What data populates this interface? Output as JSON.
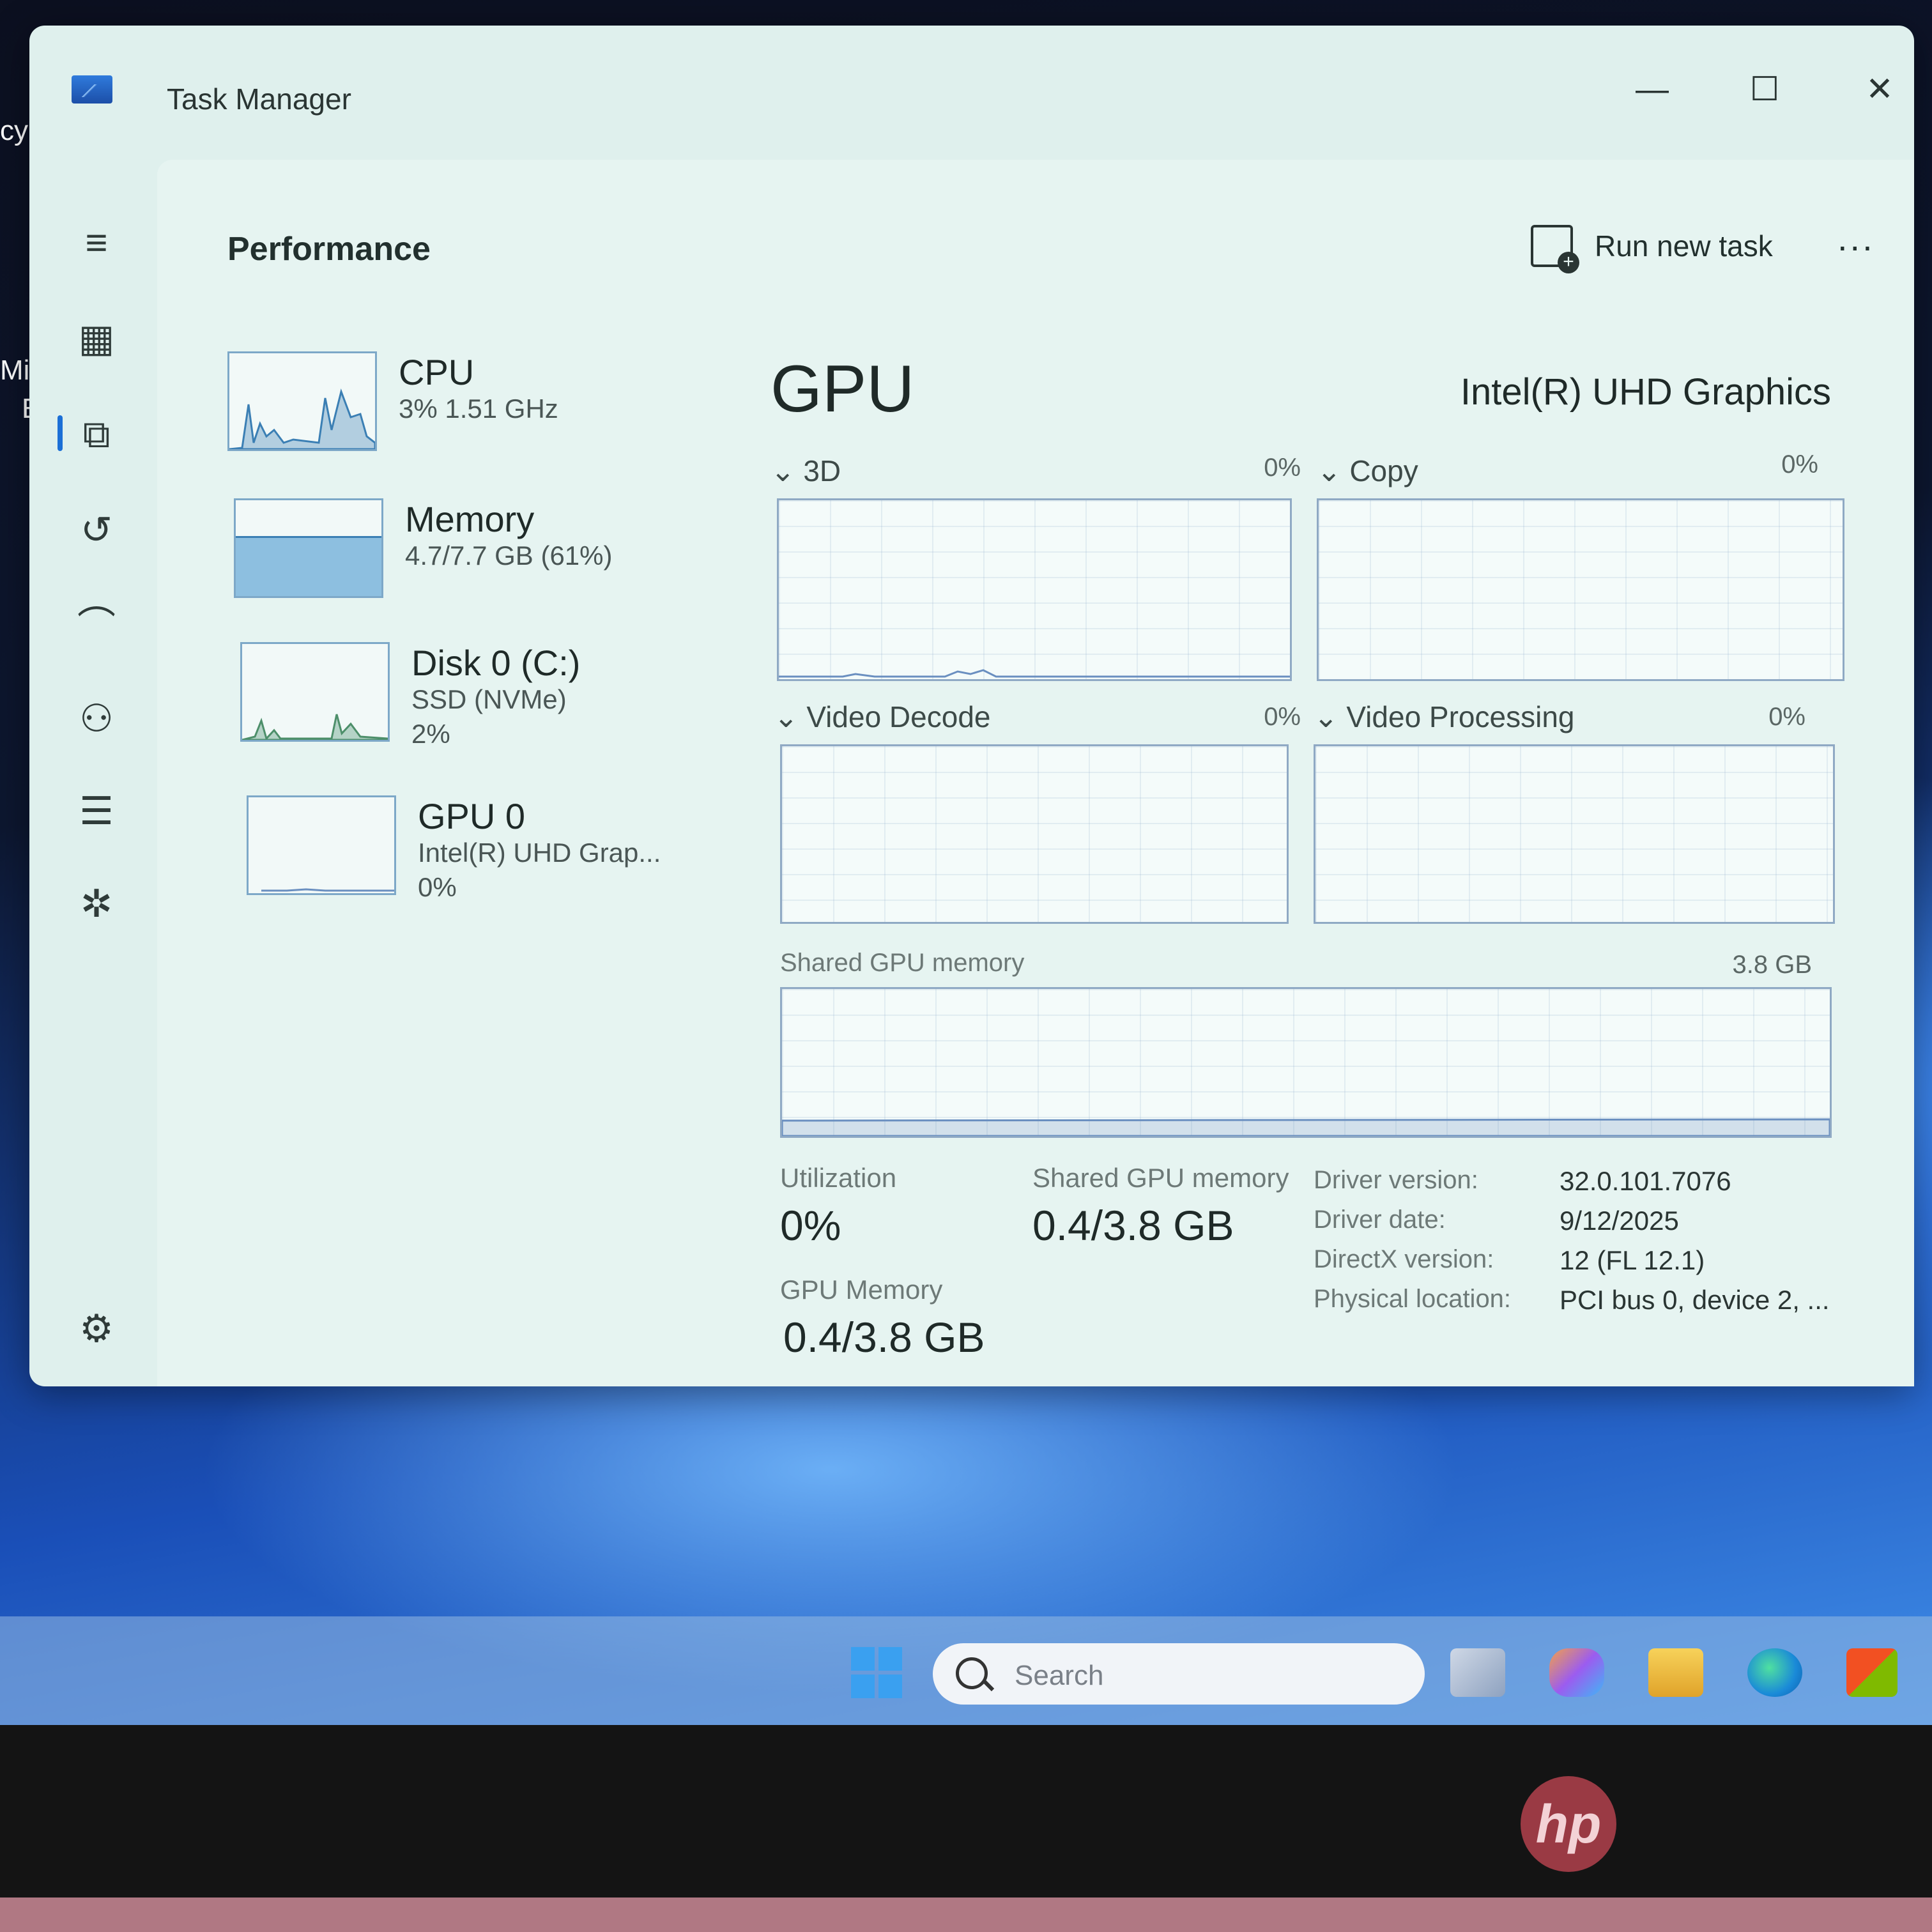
{
  "window": {
    "title": "Task Manager",
    "min_glyph": "—",
    "max_glyph": "☐",
    "close_glyph": "✕"
  },
  "header": {
    "page_title": "Performance",
    "run_new_task": "Run new task",
    "more": "..."
  },
  "devices": [
    {
      "name": "CPU",
      "sub": "3% 1.51 GHz",
      "sub2": ""
    },
    {
      "name": "Memory",
      "sub": "4.7/7.7 GB (61%)",
      "sub2": ""
    },
    {
      "name": "Disk 0 (C:)",
      "sub": "SSD (NVMe)",
      "sub2": "2%"
    },
    {
      "name": "GPU 0",
      "sub": "Intel(R) UHD Grap...",
      "sub2": "0%"
    }
  ],
  "memory_fill_fraction": 0.61,
  "gpu": {
    "title": "GPU",
    "model": "Intel(R) UHD Graphics",
    "graphs": [
      {
        "label": "3D",
        "value": "0%"
      },
      {
        "label": "Copy",
        "value": "0%"
      },
      {
        "label": "Video Decode",
        "value": "0%"
      },
      {
        "label": "Video Processing",
        "value": "0%"
      }
    ],
    "shared_graph": {
      "label": "Shared GPU memory",
      "value": "3.8 GB"
    },
    "stats": {
      "utilization_label": "Utilization",
      "utilization_value": "0%",
      "shared_label": "Shared GPU memory",
      "shared_value": "0.4/3.8 GB",
      "gpu_memory_label": "GPU Memory",
      "gpu_memory_value": "0.4/3.8 GB"
    },
    "info": [
      {
        "label": "Driver version:",
        "value": "32.0.101.7076"
      },
      {
        "label": "Driver date:",
        "value": "9/12/2025"
      },
      {
        "label": "DirectX version:",
        "value": "12 (FL 12.1)"
      },
      {
        "label": "Physical location:",
        "value": "PCI bus 0, device 2, ..."
      }
    ]
  },
  "taskbar": {
    "search_placeholder": "Search"
  },
  "desktop": {
    "label_1": "cy",
    "label_2": "Mic",
    "label_3": "Ec"
  },
  "bezel": {
    "logo": "hp"
  },
  "colors": {
    "accent": "#1b6fd6",
    "graph_line": "#6a8fc0",
    "cpu_graph": "#3b7fb4"
  }
}
